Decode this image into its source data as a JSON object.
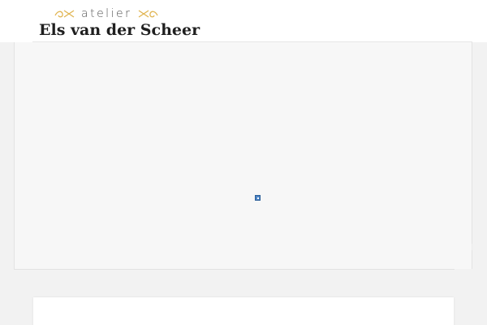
{
  "header": {
    "logo": {
      "tagline": "atelier",
      "name": "Els van der Scheer",
      "accent_color": "#e0b450"
    }
  },
  "slider": {
    "image_state": "broken-image-icon"
  },
  "colors": {
    "background": "#f2f2f2",
    "header_background": "#ffffff",
    "slider_background": "#f7f7f7",
    "card_background": "#ffffff"
  }
}
